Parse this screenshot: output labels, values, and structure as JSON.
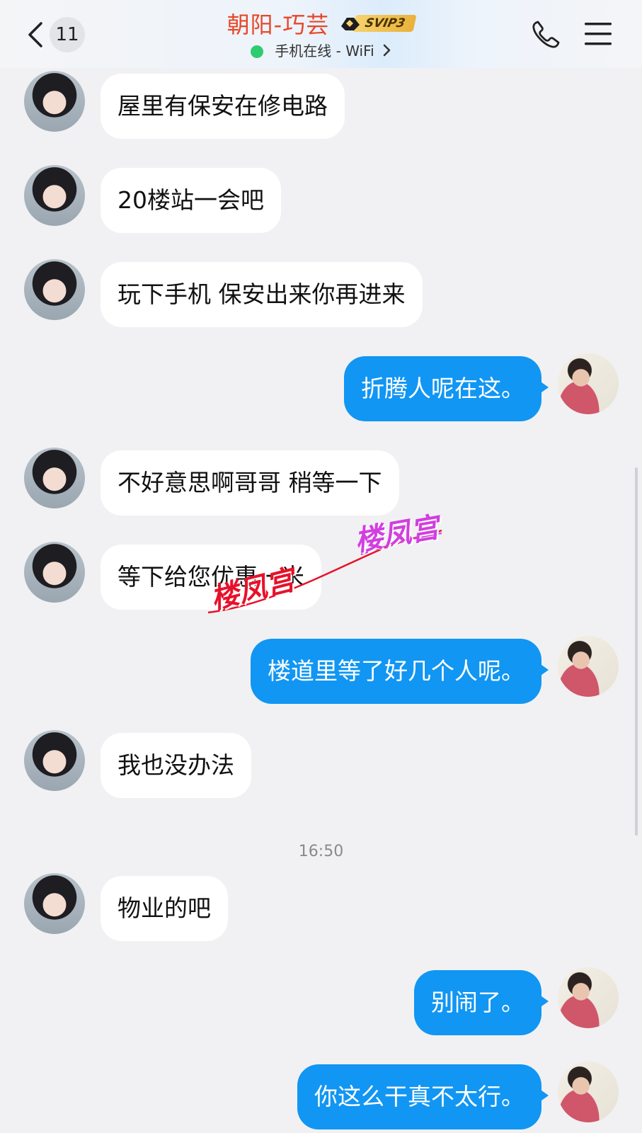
{
  "header": {
    "unread_count": "11",
    "title": "朝阳-巧芸",
    "vip_label": "SVIP3",
    "status": "手机在线 - WiFi",
    "colors": {
      "title": "#e8472a",
      "online_dot": "#2ecc71"
    }
  },
  "messages": [
    {
      "side": "left",
      "text": "屋里有保安在修电路"
    },
    {
      "side": "left",
      "text": "20楼站一会吧"
    },
    {
      "side": "left",
      "text": "玩下手机 保安出来你再进来"
    },
    {
      "side": "right",
      "text": "折腾人呢在这。"
    },
    {
      "side": "left",
      "text": "不好意思啊哥哥 稍等一下"
    },
    {
      "side": "left",
      "text": "等下给您优惠一米"
    },
    {
      "side": "right",
      "text": "楼道里等了好几个人呢。"
    },
    {
      "side": "left",
      "text": "我也没办法"
    },
    {
      "side": "left",
      "text": "物业的吧"
    },
    {
      "side": "right",
      "text": "别闹了。"
    },
    {
      "side": "right",
      "text": "你这么干真不太行。"
    }
  ],
  "timestamp": "16:50",
  "watermark": {
    "text_red": "楼凤宫",
    "text_purple": "楼凤宫"
  },
  "colors": {
    "outgoing_bubble": "#1196f3",
    "incoming_bubble": "#ffffff",
    "background": "#f1f1f3"
  },
  "icons": {
    "back": "chevron-left-icon",
    "call": "phone-icon",
    "menu": "hamburger-menu-icon"
  }
}
